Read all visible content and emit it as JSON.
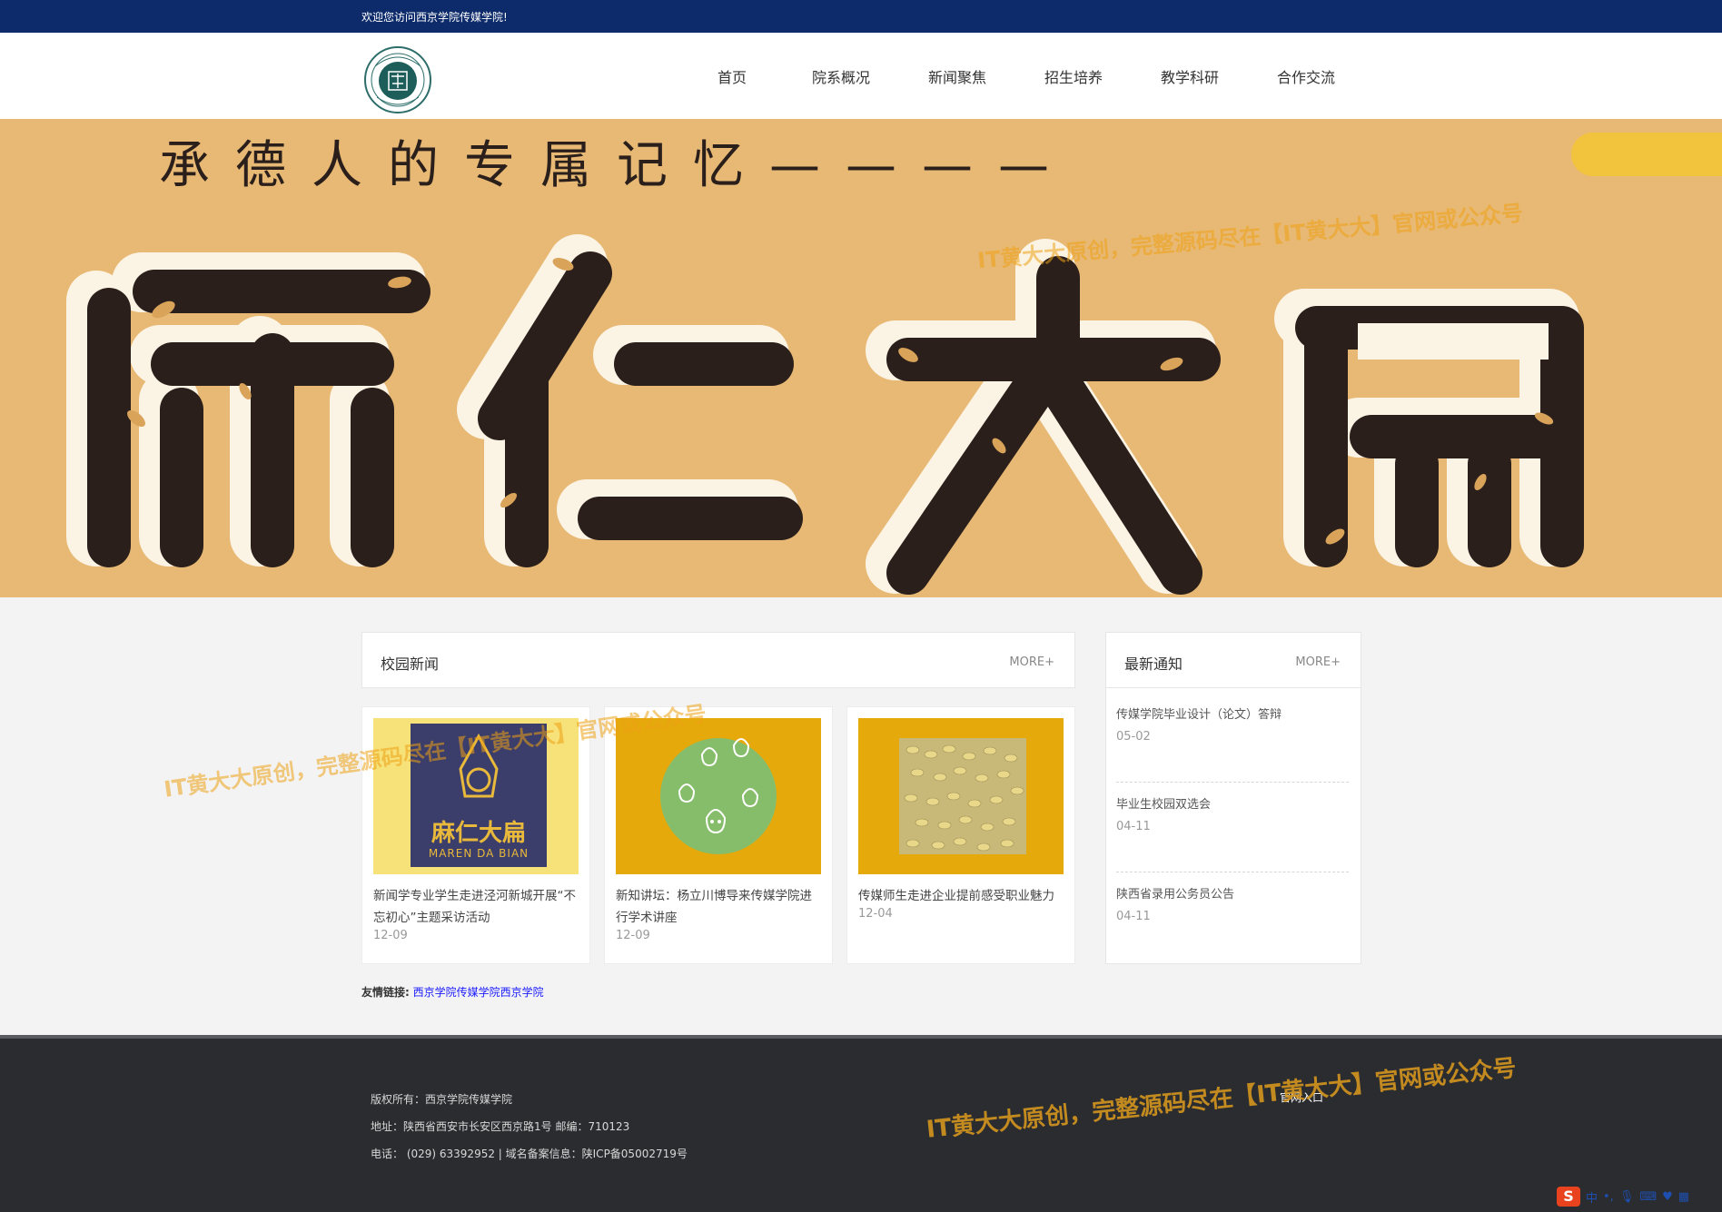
{
  "topbar": {
    "welcome": "欢迎您访问西京学院传媒学院!"
  },
  "header": {
    "logo_icon": "university-seal-icon",
    "nav": [
      "首页",
      "院系概况",
      "新闻聚焦",
      "招生培养",
      "教学科研",
      "合作交流"
    ]
  },
  "banner": {
    "slogan": "承德人的专属记忆————",
    "headline": "麻仁大扁",
    "watermark": "IT黄大大原创，完整源码尽在【IT黄大大】官网或公众号"
  },
  "news": {
    "title": "校园新闻",
    "more": "MORE+",
    "watermark": "IT黄大大原创，完整源码尽在【IT黄大大】官网或公众号",
    "items": [
      {
        "title": "新闻学专业学生走进泾河新城开展“不忘初心”主题采访活动",
        "date": "12-09",
        "image_icon": "maren-dabian-logo-image",
        "image_text": "麻仁大扁",
        "image_subtext": "MAREN DA BIAN"
      },
      {
        "title": "新知讲坛：杨立川博导来传媒学院进行学术讲座",
        "date": "12-09",
        "image_icon": "green-circle-seeds-image"
      },
      {
        "title": "传媒师生走进企业提前感受职业魅力",
        "date": "12-04",
        "image_icon": "sesame-seeds-photo"
      }
    ]
  },
  "notices": {
    "title": "最新通知",
    "more": "MORE+",
    "items": [
      {
        "title": "传媒学院毕业设计（论文）答辩",
        "date": "05-02"
      },
      {
        "title": "毕业生校园双选会",
        "date": "04-11"
      },
      {
        "title": "陕西省录用公务员公告",
        "date": "04-11"
      }
    ]
  },
  "friend_links": {
    "label": "友情链接:",
    "links": [
      "西京学院传媒学院",
      "西京学院"
    ]
  },
  "footer": {
    "copyright": "版权所有：西京学院传媒学院",
    "address": "地址：陕西省西安市长安区西京路1号 邮编：710123",
    "phone": "电话： (029) 63392952 | 域名备案信息：陕ICP备05002719号",
    "portal": "官网入口",
    "watermark": "IT黄大大原创，完整源码尽在【IT黄大大】官网或公众号"
  },
  "tray": {
    "ime_logo": "S",
    "ime_lang": "中"
  },
  "colors": {
    "topbar": "#0d2b6b",
    "banner_bg": "#e8b974",
    "glyph_dark": "#2a1f1b",
    "footer_bg": "#2b2c30",
    "watermark": "#eca014"
  }
}
